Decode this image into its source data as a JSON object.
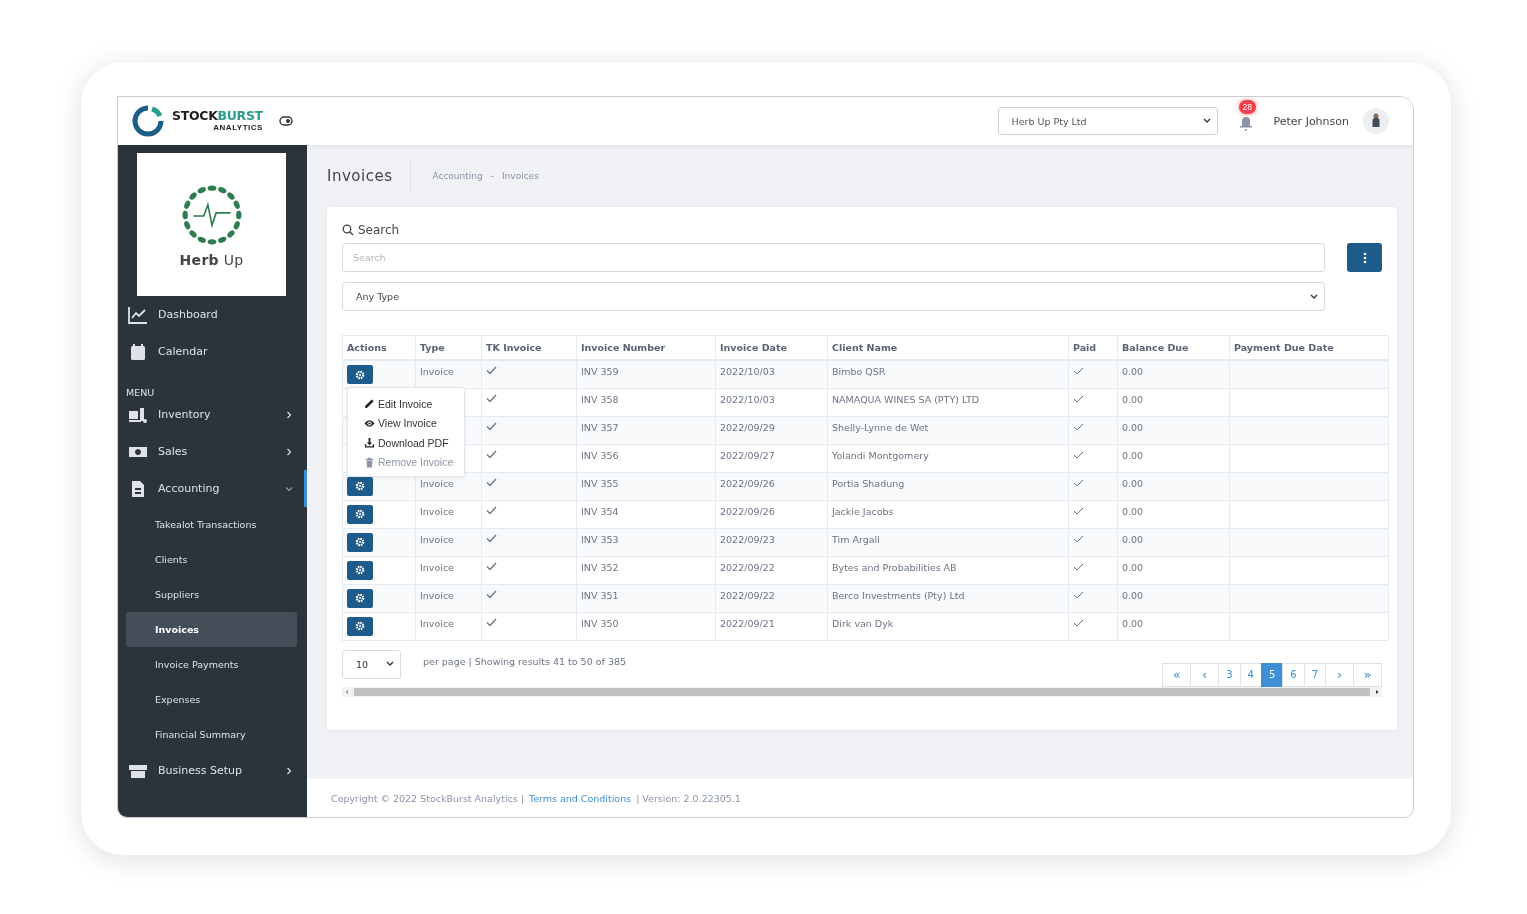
{
  "header": {
    "brand_dark": "STOCK",
    "brand_teal": "BURST",
    "brand_tagline": "ANALYTICS",
    "company_select": "Herb Up Pty Ltd",
    "notification_count": "28",
    "user_name": "Peter Johnson"
  },
  "sidebar": {
    "company_logo_text": "**Herb** Up",
    "items": [
      {
        "label": "Dashboard",
        "kind": "link"
      },
      {
        "label": "Calendar",
        "kind": "link"
      },
      {
        "label": "MENU",
        "kind": "heading"
      },
      {
        "label": "Inventory",
        "kind": "group",
        "expanded": false
      },
      {
        "label": "Sales",
        "kind": "group",
        "expanded": false
      },
      {
        "label": "Accounting",
        "kind": "group",
        "expanded": true,
        "children": [
          {
            "label": "Takealot Transactions",
            "selected": false
          },
          {
            "label": "Clients",
            "selected": false
          },
          {
            "label": "Suppliers",
            "selected": false
          },
          {
            "label": "Invoices",
            "selected": true
          },
          {
            "label": "Invoice Payments",
            "selected": false
          },
          {
            "label": "Expenses",
            "selected": false
          },
          {
            "label": "Financial Summary",
            "selected": false
          }
        ]
      },
      {
        "label": "Business Setup",
        "kind": "group",
        "expanded": false
      }
    ]
  },
  "page": {
    "title": "Invoices",
    "breadcrumb": [
      "Accounting",
      "-",
      "Invoices"
    ]
  },
  "filters": {
    "search_label": "Search",
    "search": {
      "placeholder": "Search"
    },
    "type_select": "Any Type"
  },
  "table": {
    "columns": [
      "Actions",
      "Type",
      "TK Invoice",
      "Invoice Number",
      "Invoice Date",
      "Client Name",
      "Paid",
      "Balance Due",
      "Payment Due Date"
    ],
    "rows": [
      {
        "covered": false,
        "type": "Invoice",
        "tk_invoice": true,
        "number": "INV 359",
        "date": "2022/10/03",
        "client": "Bimbo QSR",
        "paid": true,
        "balance": "0.00"
      },
      {
        "covered": true,
        "tk_invoice": true,
        "number": "INV 358",
        "date": "2022/10/03",
        "client": "NAMAQUA WINES SA (PTY) LTD",
        "paid": true,
        "balance": "0.00"
      },
      {
        "covered": true,
        "tk_invoice": true,
        "number": "INV 357",
        "date": "2022/09/29",
        "client": "Shelly-Lynne de Wet",
        "paid": true,
        "balance": "0.00"
      },
      {
        "covered": true,
        "tk_invoice": true,
        "number": "INV 356",
        "date": "2022/09/27",
        "client": "Yolandi Montgomery",
        "paid": true,
        "balance": "0.00"
      },
      {
        "covered": false,
        "type": "Invoice",
        "tk_invoice": true,
        "number": "INV 355",
        "date": "2022/09/26",
        "client": "Portia Shadung",
        "paid": true,
        "balance": "0.00"
      },
      {
        "covered": false,
        "type": "Invoice",
        "tk_invoice": true,
        "number": "INV 354",
        "date": "2022/09/26",
        "client": "Jackie Jacobs",
        "paid": true,
        "balance": "0.00"
      },
      {
        "covered": false,
        "type": "Invoice",
        "tk_invoice": true,
        "number": "INV 353",
        "date": "2022/09/23",
        "client": "Tim Argall",
        "paid": true,
        "balance": "0.00"
      },
      {
        "covered": false,
        "type": "Invoice",
        "tk_invoice": true,
        "number": "INV 352",
        "date": "2022/09/22",
        "client": "Bytes and Probabilities AB",
        "paid": true,
        "balance": "0.00"
      },
      {
        "covered": false,
        "type": "Invoice",
        "tk_invoice": true,
        "number": "INV 351",
        "date": "2022/09/22",
        "client": "Berco Investments (Pty) Ltd",
        "paid": true,
        "balance": "0.00"
      },
      {
        "covered": false,
        "type": "Invoice",
        "tk_invoice": true,
        "number": "INV 350",
        "date": "2022/09/21",
        "client": "Dirk van Dyk",
        "paid": true,
        "balance": "0.00"
      }
    ]
  },
  "action_menu": [
    {
      "label": "Edit Invoice",
      "disabled": false
    },
    {
      "label": "View Invoice",
      "disabled": false
    },
    {
      "label": "Download PDF",
      "disabled": false
    },
    {
      "label": "Remove Invoice",
      "disabled": true
    }
  ],
  "pager": {
    "per_page": "10",
    "summary": "per page | Showing results 41 to 50 of 385",
    "buttons": [
      {
        "label": "«",
        "selected": false
      },
      {
        "label": "‹",
        "selected": false
      },
      {
        "label": "3",
        "selected": false
      },
      {
        "label": "4",
        "selected": false
      },
      {
        "label": "5",
        "selected": true
      },
      {
        "label": "6",
        "selected": false
      },
      {
        "label": "7",
        "selected": false
      },
      {
        "label": "›",
        "selected": false
      },
      {
        "label": "»",
        "selected": false
      }
    ]
  },
  "footer": {
    "copyright": "Copyright © 2022 StockBurst Analytics |",
    "link": "Terms and Conditions",
    "version": "| Version: 2.0.22305.1"
  }
}
